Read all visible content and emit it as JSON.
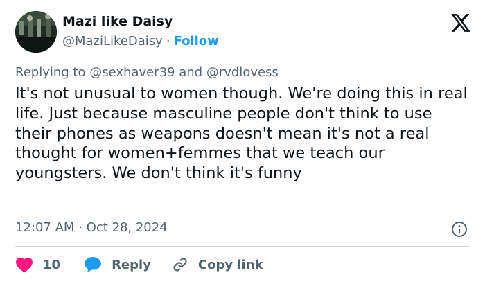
{
  "tweet": {
    "author_name": "Mazi like Daisy",
    "author_handle": "@MaziLikeDaisy",
    "separator": "·",
    "follow_label": "Follow",
    "replying_prefix": "Replying to",
    "replying_user_1": "@sexhaver39",
    "replying_and": "and",
    "replying_user_2": "@rvdlovess",
    "text": "It's not unusual to women though. We're doing this in real life. Just because masculine people don't think to use their phones as weapons doesn't mean it's not a real thought for women+femmes that we teach our youngsters. We don't think it's funny",
    "time": "12:07 AM",
    "date": "Oct 28, 2024"
  },
  "actions": {
    "like_count": "10",
    "reply_label": "Reply",
    "copy_link_label": "Copy link"
  },
  "icons": {
    "logo": "x-logo-icon",
    "info": "info-icon",
    "like": "heart-icon",
    "reply": "speech-bubble-icon",
    "copy": "link-icon"
  },
  "colors": {
    "accent": "#1d9bf0",
    "like": "#f91880",
    "text": "#0f1419",
    "muted": "#536471"
  }
}
